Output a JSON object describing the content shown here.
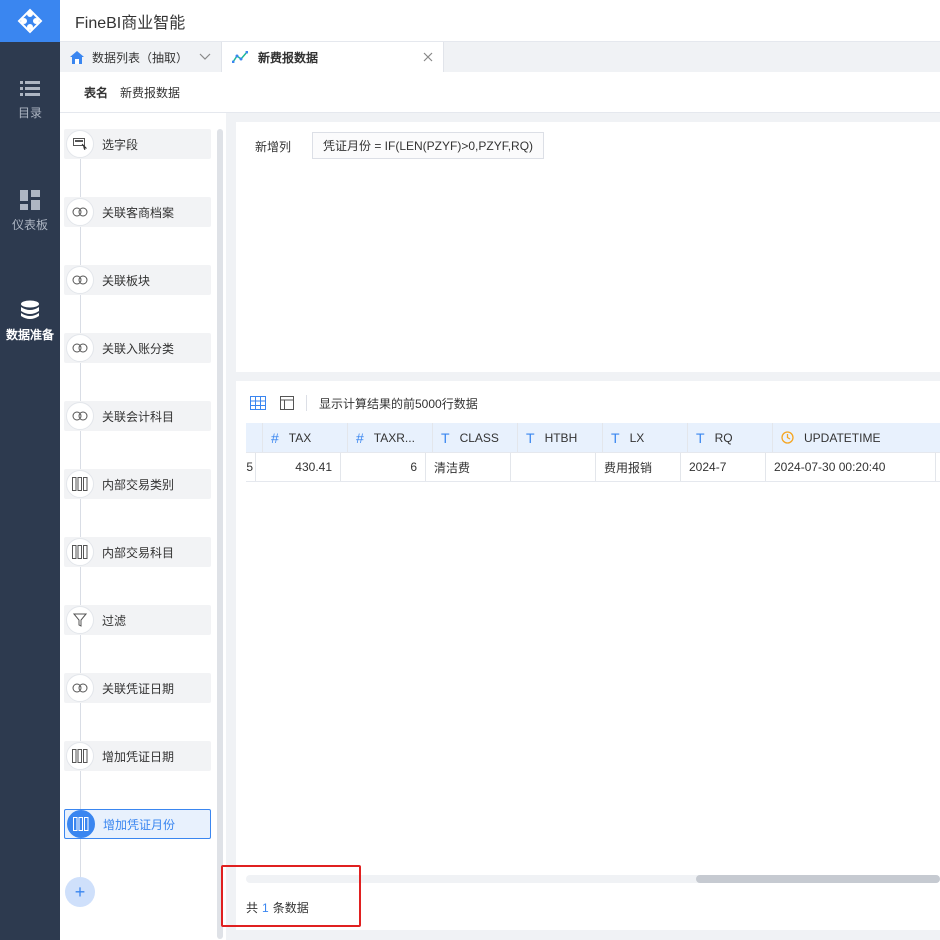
{
  "app": {
    "title": "FineBI商业智能"
  },
  "nav": {
    "items": [
      {
        "label": "目录",
        "icon": "list-icon"
      },
      {
        "label": "仪表板",
        "icon": "dashboard-icon"
      },
      {
        "label": "数据准备",
        "icon": "database-icon",
        "active": true
      }
    ]
  },
  "tabs": [
    {
      "label": "数据列表（抽取）",
      "icon": "home-icon"
    },
    {
      "label": "新费报数据",
      "icon": "line-chart-icon"
    }
  ],
  "table_name": {
    "label": "表名",
    "value": "新费报数据"
  },
  "steps": [
    {
      "label": "选字段",
      "icon": "select-field-icon"
    },
    {
      "label": "关联客商档案",
      "icon": "join-icon"
    },
    {
      "label": "关联板块",
      "icon": "join-icon"
    },
    {
      "label": "关联入账分类",
      "icon": "join-icon"
    },
    {
      "label": "关联会计科目",
      "icon": "join-icon"
    },
    {
      "label": "内部交易类别",
      "icon": "add-column-icon"
    },
    {
      "label": "内部交易科目",
      "icon": "add-column-icon"
    },
    {
      "label": "过滤",
      "icon": "filter-icon"
    },
    {
      "label": "关联凭证日期",
      "icon": "join-icon"
    },
    {
      "label": "增加凭证日期",
      "icon": "add-column-icon"
    },
    {
      "label": "增加凭证月份",
      "icon": "add-column-icon",
      "active": true
    }
  ],
  "formula": {
    "label": "新增列",
    "expression": "凭证月份 = IF(LEN(PZYF)>0,PZYF,RQ)"
  },
  "toolbar": {
    "hint": "显示计算结果的前5000行数据"
  },
  "grid": {
    "columns": [
      {
        "name": "",
        "type": "#",
        "partial": true
      },
      {
        "name": "TAX",
        "type": "#"
      },
      {
        "name": "TAXR...",
        "type": "#"
      },
      {
        "name": "CLASS",
        "type": "T"
      },
      {
        "name": "HTBH",
        "type": "T"
      },
      {
        "name": "LX",
        "type": "T"
      },
      {
        "name": "RQ",
        "type": "T"
      },
      {
        "name": "UPDATETIME",
        "type": "clock"
      }
    ],
    "rows": [
      [
        "5",
        "430.41",
        "6",
        "清洁费",
        "",
        "费用报销",
        "2024-7",
        "2024-07-30 00:20:40"
      ]
    ]
  },
  "count": {
    "prefix": "共",
    "value": "1",
    "suffix": "条数据"
  },
  "colors": {
    "accent": "#3a86f0",
    "nav_bg": "#2d3a4f",
    "highlight": "#e02020"
  }
}
